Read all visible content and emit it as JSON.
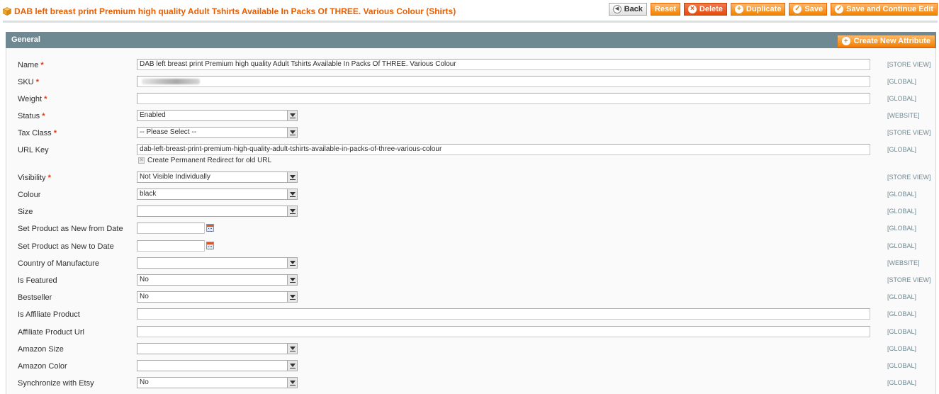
{
  "header": {
    "title": "DAB left breast print Premium high quality Adult Tshirts Available In Packs Of THREE. Various Colour (Shirts)",
    "buttons": {
      "back": "Back",
      "reset": "Reset",
      "delete": "Delete",
      "duplicate": "Duplicate",
      "save": "Save",
      "save_continue": "Save and Continue Edit"
    }
  },
  "panel": {
    "title": "General",
    "create_attribute": "Create New Attribute"
  },
  "fields": {
    "name": {
      "label": "Name",
      "required": "*",
      "value": "DAB left breast print Premium high quality Adult Tshirts Available In Packs Of THREE. Various Colour",
      "scope": "[STORE VIEW]"
    },
    "sku": {
      "label": "SKU",
      "required": "*",
      "value": "",
      "scope": "[GLOBAL]"
    },
    "weight": {
      "label": "Weight",
      "required": "*",
      "value": "",
      "scope": "[GLOBAL]"
    },
    "status": {
      "label": "Status",
      "required": "*",
      "value": "Enabled",
      "scope": "[WEBSITE]"
    },
    "tax_class": {
      "label": "Tax Class",
      "required": "*",
      "value": "-- Please Select --",
      "scope": "[STORE VIEW]"
    },
    "url_key": {
      "label": "URL Key",
      "value": "dab-left-breast-print-premium-high-quality-adult-tshirts-available-in-packs-of-three-various-colour",
      "redirect_label": "Create Permanent Redirect for old URL",
      "scope": "[GLOBAL]"
    },
    "visibility": {
      "label": "Visibility",
      "required": "*",
      "value": "Not Visible Individually",
      "scope": "[STORE VIEW]"
    },
    "colour": {
      "label": "Colour",
      "value": "black",
      "scope": "[GLOBAL]"
    },
    "size": {
      "label": "Size",
      "value": "",
      "scope": "[GLOBAL]"
    },
    "new_from": {
      "label": "Set Product as New from Date",
      "value": "",
      "scope": "[GLOBAL]"
    },
    "new_to": {
      "label": "Set Product as New to Date",
      "value": "",
      "scope": "[GLOBAL]"
    },
    "country": {
      "label": "Country of Manufacture",
      "value": "",
      "scope": "[WEBSITE]"
    },
    "is_featured": {
      "label": "Is Featured",
      "value": "No",
      "scope": "[STORE VIEW]"
    },
    "bestseller": {
      "label": "Bestseller",
      "value": "No",
      "scope": "[GLOBAL]"
    },
    "is_affiliate": {
      "label": "Is Affiliate Product",
      "value": "",
      "scope": "[GLOBAL]"
    },
    "affiliate_url": {
      "label": "Affiliate Product Url",
      "value": "",
      "scope": "[GLOBAL]"
    },
    "amazon_size": {
      "label": "Amazon Size",
      "value": "",
      "scope": "[GLOBAL]"
    },
    "amazon_color": {
      "label": "Amazon Color",
      "value": "",
      "scope": "[GLOBAL]"
    },
    "etsy": {
      "label": "Synchronize with Etsy",
      "value": "No",
      "scope": "[GLOBAL]"
    }
  },
  "colors": {
    "title_orange": "#eb5e00",
    "panel_header": "#6f8992",
    "button_orange": "#f18200",
    "required_red": "#eb340a"
  }
}
